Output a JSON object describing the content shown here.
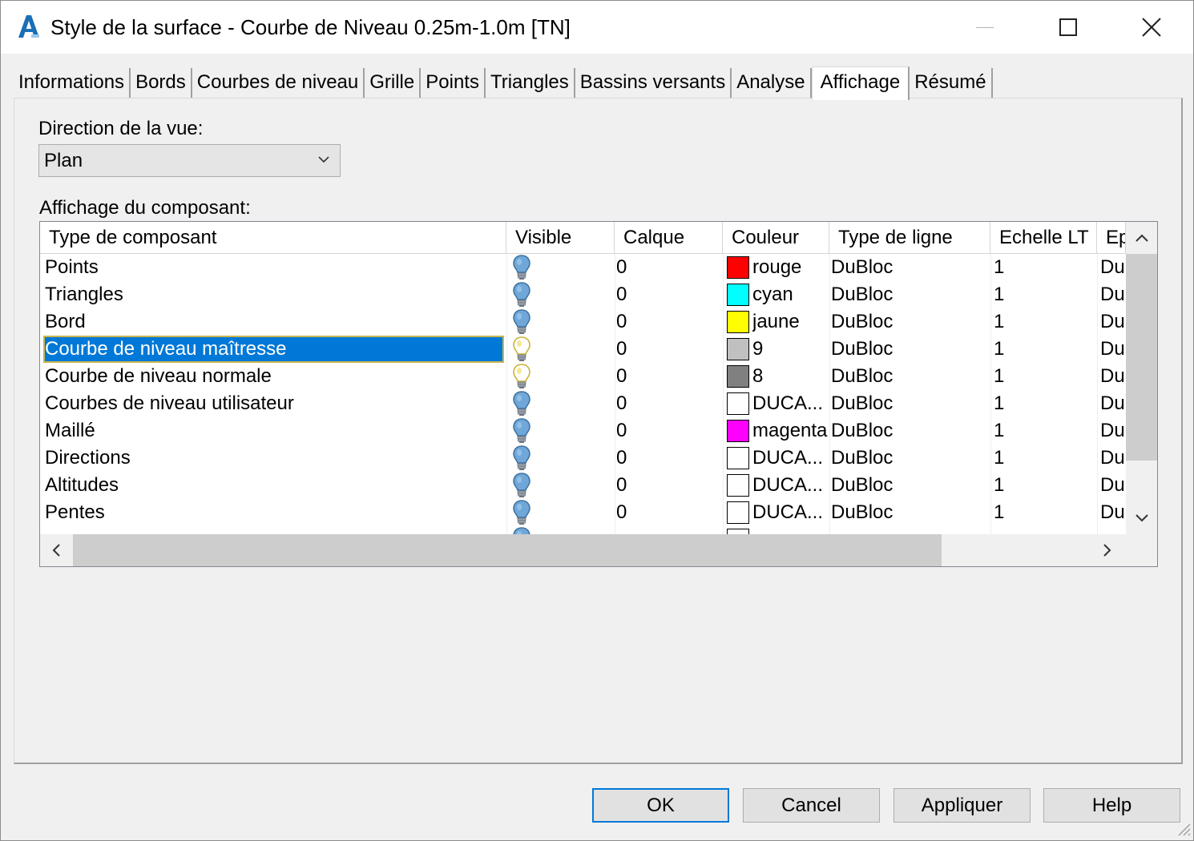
{
  "window": {
    "title": "Style de la surface - Courbe de Niveau 0.25m-1.0m [TN]",
    "app_icon": "autocad-a-icon"
  },
  "tabs": [
    {
      "label": "Informations",
      "active": false
    },
    {
      "label": "Bords",
      "active": false
    },
    {
      "label": "Courbes de niveau",
      "active": false
    },
    {
      "label": "Grille",
      "active": false
    },
    {
      "label": "Points",
      "active": false
    },
    {
      "label": "Triangles",
      "active": false
    },
    {
      "label": "Bassins versants",
      "active": false
    },
    {
      "label": "Analyse",
      "active": false
    },
    {
      "label": "Affichage",
      "active": true
    },
    {
      "label": "Résumé",
      "active": false
    }
  ],
  "view_direction": {
    "label": "Direction de la vue:",
    "value": "Plan"
  },
  "component_display": {
    "label": "Affichage du composant:",
    "columns": [
      "Type de composant",
      "Visible",
      "Calque",
      "Couleur",
      "Type de ligne",
      "Echelle LT",
      "Ep"
    ],
    "rows": [
      {
        "type": "Points",
        "visible": "on",
        "calque": "0",
        "swatch": "#ff0000",
        "couleur": "rouge",
        "ltype": "DuBloc",
        "echelle": "1",
        "ep": "Du"
      },
      {
        "type": "Triangles",
        "visible": "on",
        "calque": "0",
        "swatch": "#00ffff",
        "couleur": "cyan",
        "ltype": "DuBloc",
        "echelle": "1",
        "ep": "Du"
      },
      {
        "type": "Bord",
        "visible": "on",
        "calque": "0",
        "swatch": "#ffff00",
        "couleur": "jaune",
        "ltype": "DuBloc",
        "echelle": "1",
        "ep": "Du"
      },
      {
        "type": "Courbe de niveau maîtresse",
        "visible": "off",
        "calque": "0",
        "swatch": "#c0c0c0",
        "couleur": "9",
        "ltype": "DuBloc",
        "echelle": "1",
        "ep": "Du",
        "selected": true
      },
      {
        "type": "Courbe de niveau normale",
        "visible": "off",
        "calque": "0",
        "swatch": "#808080",
        "couleur": "8",
        "ltype": "DuBloc",
        "echelle": "1",
        "ep": "Du"
      },
      {
        "type": "Courbes de niveau utilisateur",
        "visible": "on",
        "calque": "0",
        "swatch": "#ffffff",
        "couleur": "DUCA...",
        "ltype": "DuBloc",
        "echelle": "1",
        "ep": "Du"
      },
      {
        "type": "Maillé",
        "visible": "on",
        "calque": "0",
        "swatch": "#ff00ff",
        "couleur": "magenta",
        "ltype": "DuBloc",
        "echelle": "1",
        "ep": "Du"
      },
      {
        "type": "Directions",
        "visible": "on",
        "calque": "0",
        "swatch": "#ffffff",
        "couleur": "DUCA...",
        "ltype": "DuBloc",
        "echelle": "1",
        "ep": "Du"
      },
      {
        "type": "Altitudes",
        "visible": "on",
        "calque": "0",
        "swatch": "#ffffff",
        "couleur": "DUCA...",
        "ltype": "DuBloc",
        "echelle": "1",
        "ep": "Du"
      },
      {
        "type": "Pentes",
        "visible": "on",
        "calque": "0",
        "swatch": "#ffffff",
        "couleur": "DUCA...",
        "ltype": "DuBloc",
        "echelle": "1",
        "ep": "Du"
      }
    ],
    "partial_row_visible": true
  },
  "buttons": {
    "ok": "OK",
    "cancel": "Cancel",
    "apply": "Appliquer",
    "help": "Help"
  },
  "colors": {
    "selection": "#0078d7",
    "bulb_on": "#6fa8d8",
    "bulb_off": "#f2e27a"
  }
}
